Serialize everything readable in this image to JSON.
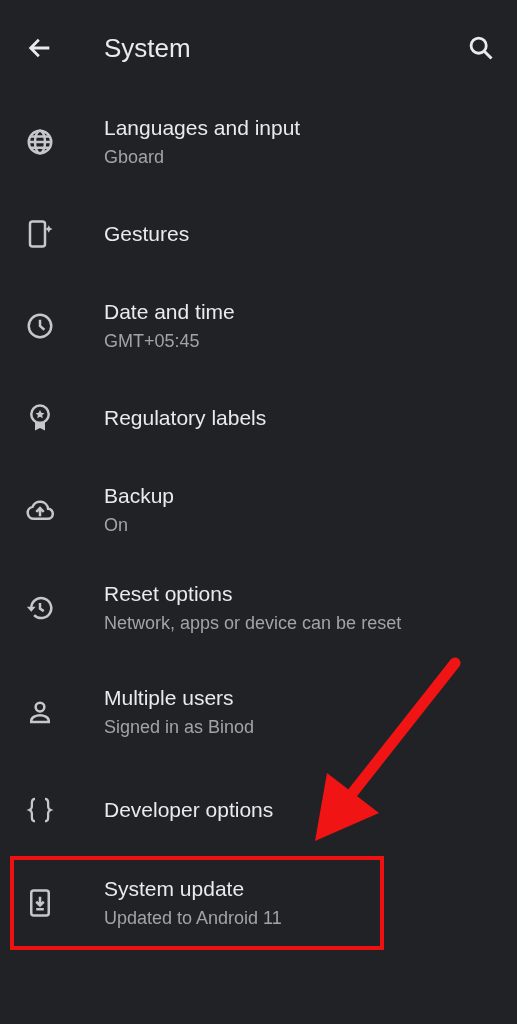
{
  "app_bar": {
    "title": "System"
  },
  "items": [
    {
      "title": "Languages and input",
      "subtitle": "Gboard",
      "highlighted": false
    },
    {
      "title": "Gestures",
      "highlighted": false
    },
    {
      "title": "Date and time",
      "subtitle": "GMT+05:45",
      "highlighted": false
    },
    {
      "title": "Regulatory labels",
      "highlighted": false
    },
    {
      "title": "Backup",
      "subtitle": "On",
      "highlighted": false
    },
    {
      "title": "Reset options",
      "subtitle": "Network, apps or device can be reset",
      "highlighted": false
    },
    {
      "title": "Multiple users",
      "subtitle": "Signed in as Binod",
      "highlighted": false
    },
    {
      "title": "Developer options",
      "highlighted": false
    },
    {
      "title": "System update",
      "subtitle": "Updated to Android 11",
      "highlighted": true
    }
  ]
}
